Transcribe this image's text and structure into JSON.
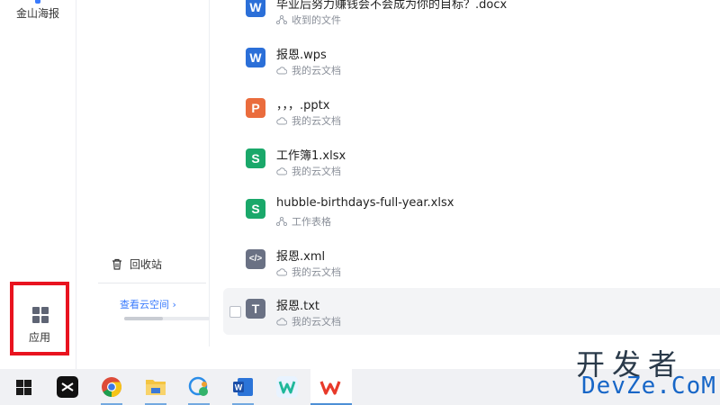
{
  "rail": {
    "top_item_label": "金山海报",
    "apps_label": "应用"
  },
  "sidebar": {
    "trash_label": "回收站",
    "cloud_link": "查看云空间 ›",
    "storage_fraction": 0.45
  },
  "files": [
    {
      "name": "毕业后努力赚钱会不会成为你的目标？.docx",
      "location": "收到的文件",
      "type": "writer",
      "icon_letter": "W",
      "color": "#2b6fd8",
      "loc_icon": "share-icon"
    },
    {
      "name": "报恩.wps",
      "location": "我的云文档",
      "type": "writer",
      "icon_letter": "W",
      "color": "#2b6fd8",
      "loc_icon": "cloud-icon"
    },
    {
      "name": "，，，.pptx",
      "location": "我的云文档",
      "type": "presentation",
      "icon_letter": "P",
      "color": "#ea6c3d",
      "loc_icon": "cloud-icon"
    },
    {
      "name": "工作簿1.xlsx",
      "location": "我的云文档",
      "type": "spreadsheet",
      "icon_letter": "S",
      "color": "#1aa86a",
      "loc_icon": "cloud-icon"
    },
    {
      "name": "hubble-birthdays-full-year.xlsx",
      "location": "工作表格",
      "type": "spreadsheet",
      "icon_letter": "S",
      "color": "#1aa86a",
      "loc_icon": "share-icon"
    },
    {
      "name": "报恩.xml",
      "location": "我的云文档",
      "type": "code",
      "icon_letter": "</>",
      "color": "#6a7184",
      "loc_icon": "cloud-icon"
    },
    {
      "name": "报恩.txt",
      "location": "我的云文档",
      "type": "text",
      "icon_letter": "T",
      "color": "#6a7184",
      "loc_icon": "cloud-icon"
    }
  ],
  "taskbar": {
    "items": [
      "windows-start",
      "capcut",
      "chrome",
      "file-explorer",
      "chat-app",
      "word",
      "wps-writer",
      "wps-office"
    ]
  },
  "watermark": {
    "cn": "开发者",
    "en": "DevZe.CoM"
  }
}
